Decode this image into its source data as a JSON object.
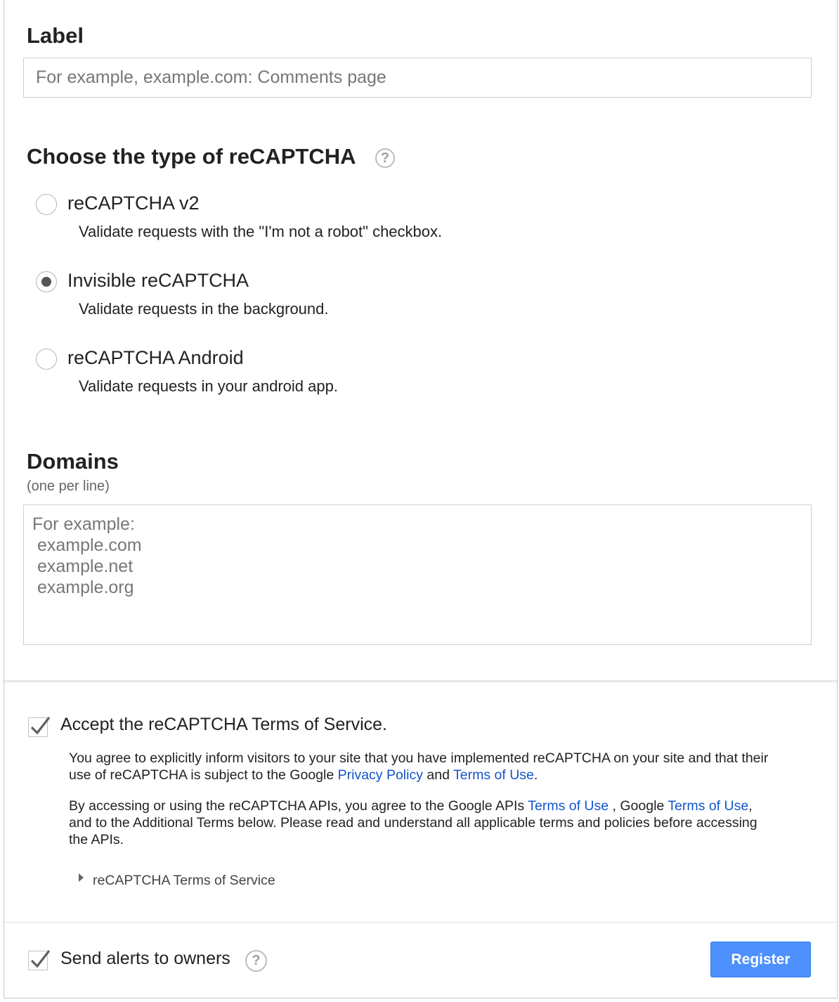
{
  "label_section": {
    "title": "Label",
    "placeholder": "For example, example.com: Comments page"
  },
  "type_section": {
    "title": "Choose the type of reCAPTCHA",
    "help_glyph": "?",
    "options": [
      {
        "label": "reCAPTCHA v2",
        "description": "Validate requests with the \"I'm not a robot\" checkbox.",
        "selected": false
      },
      {
        "label": "Invisible reCAPTCHA",
        "description": "Validate requests in the background.",
        "selected": true
      },
      {
        "label": "reCAPTCHA Android",
        "description": "Validate requests in your android app.",
        "selected": false
      }
    ]
  },
  "domains_section": {
    "title": "Domains",
    "subtitle": "(one per line)",
    "placeholder": "For example:\n example.com\n example.net\n example.org"
  },
  "tos": {
    "checkbox_label": "Accept the reCAPTCHA Terms of Service.",
    "checked": true,
    "p1_part1": "You agree to explicitly inform visitors to your site that you have implemented reCAPTCHA on your site and that their use of reCAPTCHA is subject to the Google ",
    "p1_link1": "Privacy Policy",
    "p1_part2": " and ",
    "p1_link2": "Terms of Use",
    "p1_part3": ".",
    "p2_part1": "By accessing or using the reCAPTCHA APIs, you agree to the Google APIs ",
    "p2_link1": "Terms of Use",
    "p2_part2": " , Google ",
    "p2_link2": "Terms of Use",
    "p2_part3": ", and to the Additional Terms below. Please read and understand all applicable terms and policies before accessing the APIs.",
    "expander_label": "reCAPTCHA Terms of Service"
  },
  "alerts": {
    "checkbox_label": "Send alerts to owners",
    "checked": true,
    "help_glyph": "?"
  },
  "register_button": "Register",
  "colors": {
    "link": "#1155cc",
    "button": "#4d90fe",
    "placeholder": "#777777"
  }
}
